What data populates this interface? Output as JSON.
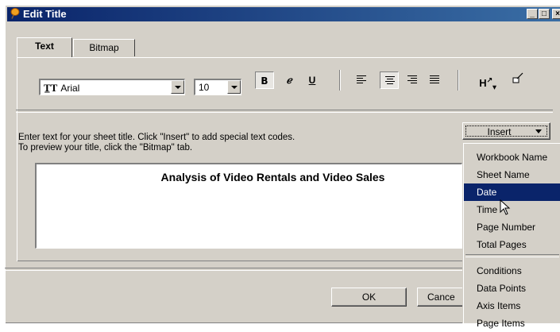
{
  "window": {
    "title": "Edit Title",
    "icon": "pin-icon",
    "controls": [
      "minimize",
      "maximize",
      "close"
    ]
  },
  "tabs": [
    {
      "label": "Text",
      "active": true
    },
    {
      "label": "Bitmap",
      "active": false
    }
  ],
  "toolbar": {
    "font_value": "Arial",
    "font_icon": "truetype-icon",
    "size_value": "10",
    "bold_label": "B",
    "italic_label": "ℯ",
    "underline_label": "U",
    "align_left": "align-left-icon",
    "align_center": "align-center-icon",
    "align_right": "align-right-icon",
    "justify": "justify-icon",
    "heading_style": "heading-style-icon",
    "color_brush": "paint-brush-icon"
  },
  "instructions": {
    "line1": "Enter text for your sheet title. Click \"Insert\" to add special text codes.",
    "line2": "To preview your title, click the \"Bitmap\" tab."
  },
  "insert_button": "Insert",
  "title_text": "Analysis of Video Rentals and Video Sales",
  "insert_menu": {
    "items": [
      "Workbook Name",
      "Sheet Name",
      "Date",
      "Time",
      "Page Number",
      "Total Pages"
    ],
    "items2": [
      "Conditions",
      "Data Points",
      "Axis Items",
      "Page Items"
    ],
    "selected": "Date"
  },
  "buttons": {
    "ok": "OK",
    "cancel": "Cance"
  },
  "colors": {
    "titlebar_start": "#0a246a",
    "titlebar_end": "#3a6ea5",
    "face": "#d4d0c8",
    "highlight": "#0a246a"
  }
}
